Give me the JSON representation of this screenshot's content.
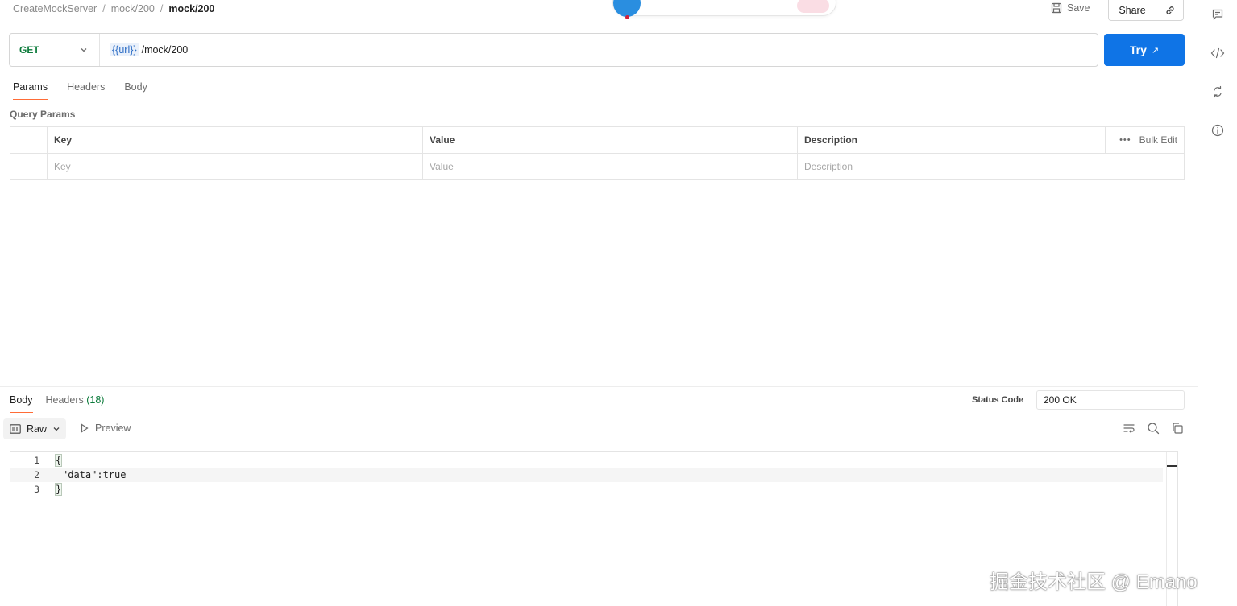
{
  "breadcrumb": {
    "items": [
      "CreateMockServer",
      "mock/200"
    ],
    "current": "mock/200",
    "separator": "/"
  },
  "topbar": {
    "save_label": "Save",
    "share_label": "Share"
  },
  "request": {
    "method": "GET",
    "url_variable": "{{url}}",
    "url_path": "/mock/200",
    "try_label": "Try",
    "tabs": [
      {
        "label": "Params",
        "active": true
      },
      {
        "label": "Headers",
        "active": false
      },
      {
        "label": "Body",
        "active": false
      }
    ],
    "query_params_title": "Query Params",
    "table": {
      "columns": [
        "Key",
        "Value",
        "Description"
      ],
      "bulk_edit_label": "Bulk Edit",
      "placeholders": [
        "Key",
        "Value",
        "Description"
      ]
    }
  },
  "response": {
    "tabs": [
      {
        "label": "Body",
        "active": true
      },
      {
        "label": "Headers",
        "count": "(18)",
        "active": false
      }
    ],
    "status_code_label": "Status Code",
    "status_code_value": "200 OK",
    "format_label": "Raw",
    "preview_label": "Preview",
    "code_lines": [
      {
        "number": "1",
        "text": "{"
      },
      {
        "number": "2",
        "text": "\"data\":true"
      },
      {
        "number": "3",
        "text": "}"
      }
    ]
  },
  "watermark": "掘金技术社区 @ Emanon",
  "colors": {
    "accent_blue": "#0f74e6",
    "method_green": "#0b7a3a",
    "tab_underline": "#ff6c37"
  }
}
